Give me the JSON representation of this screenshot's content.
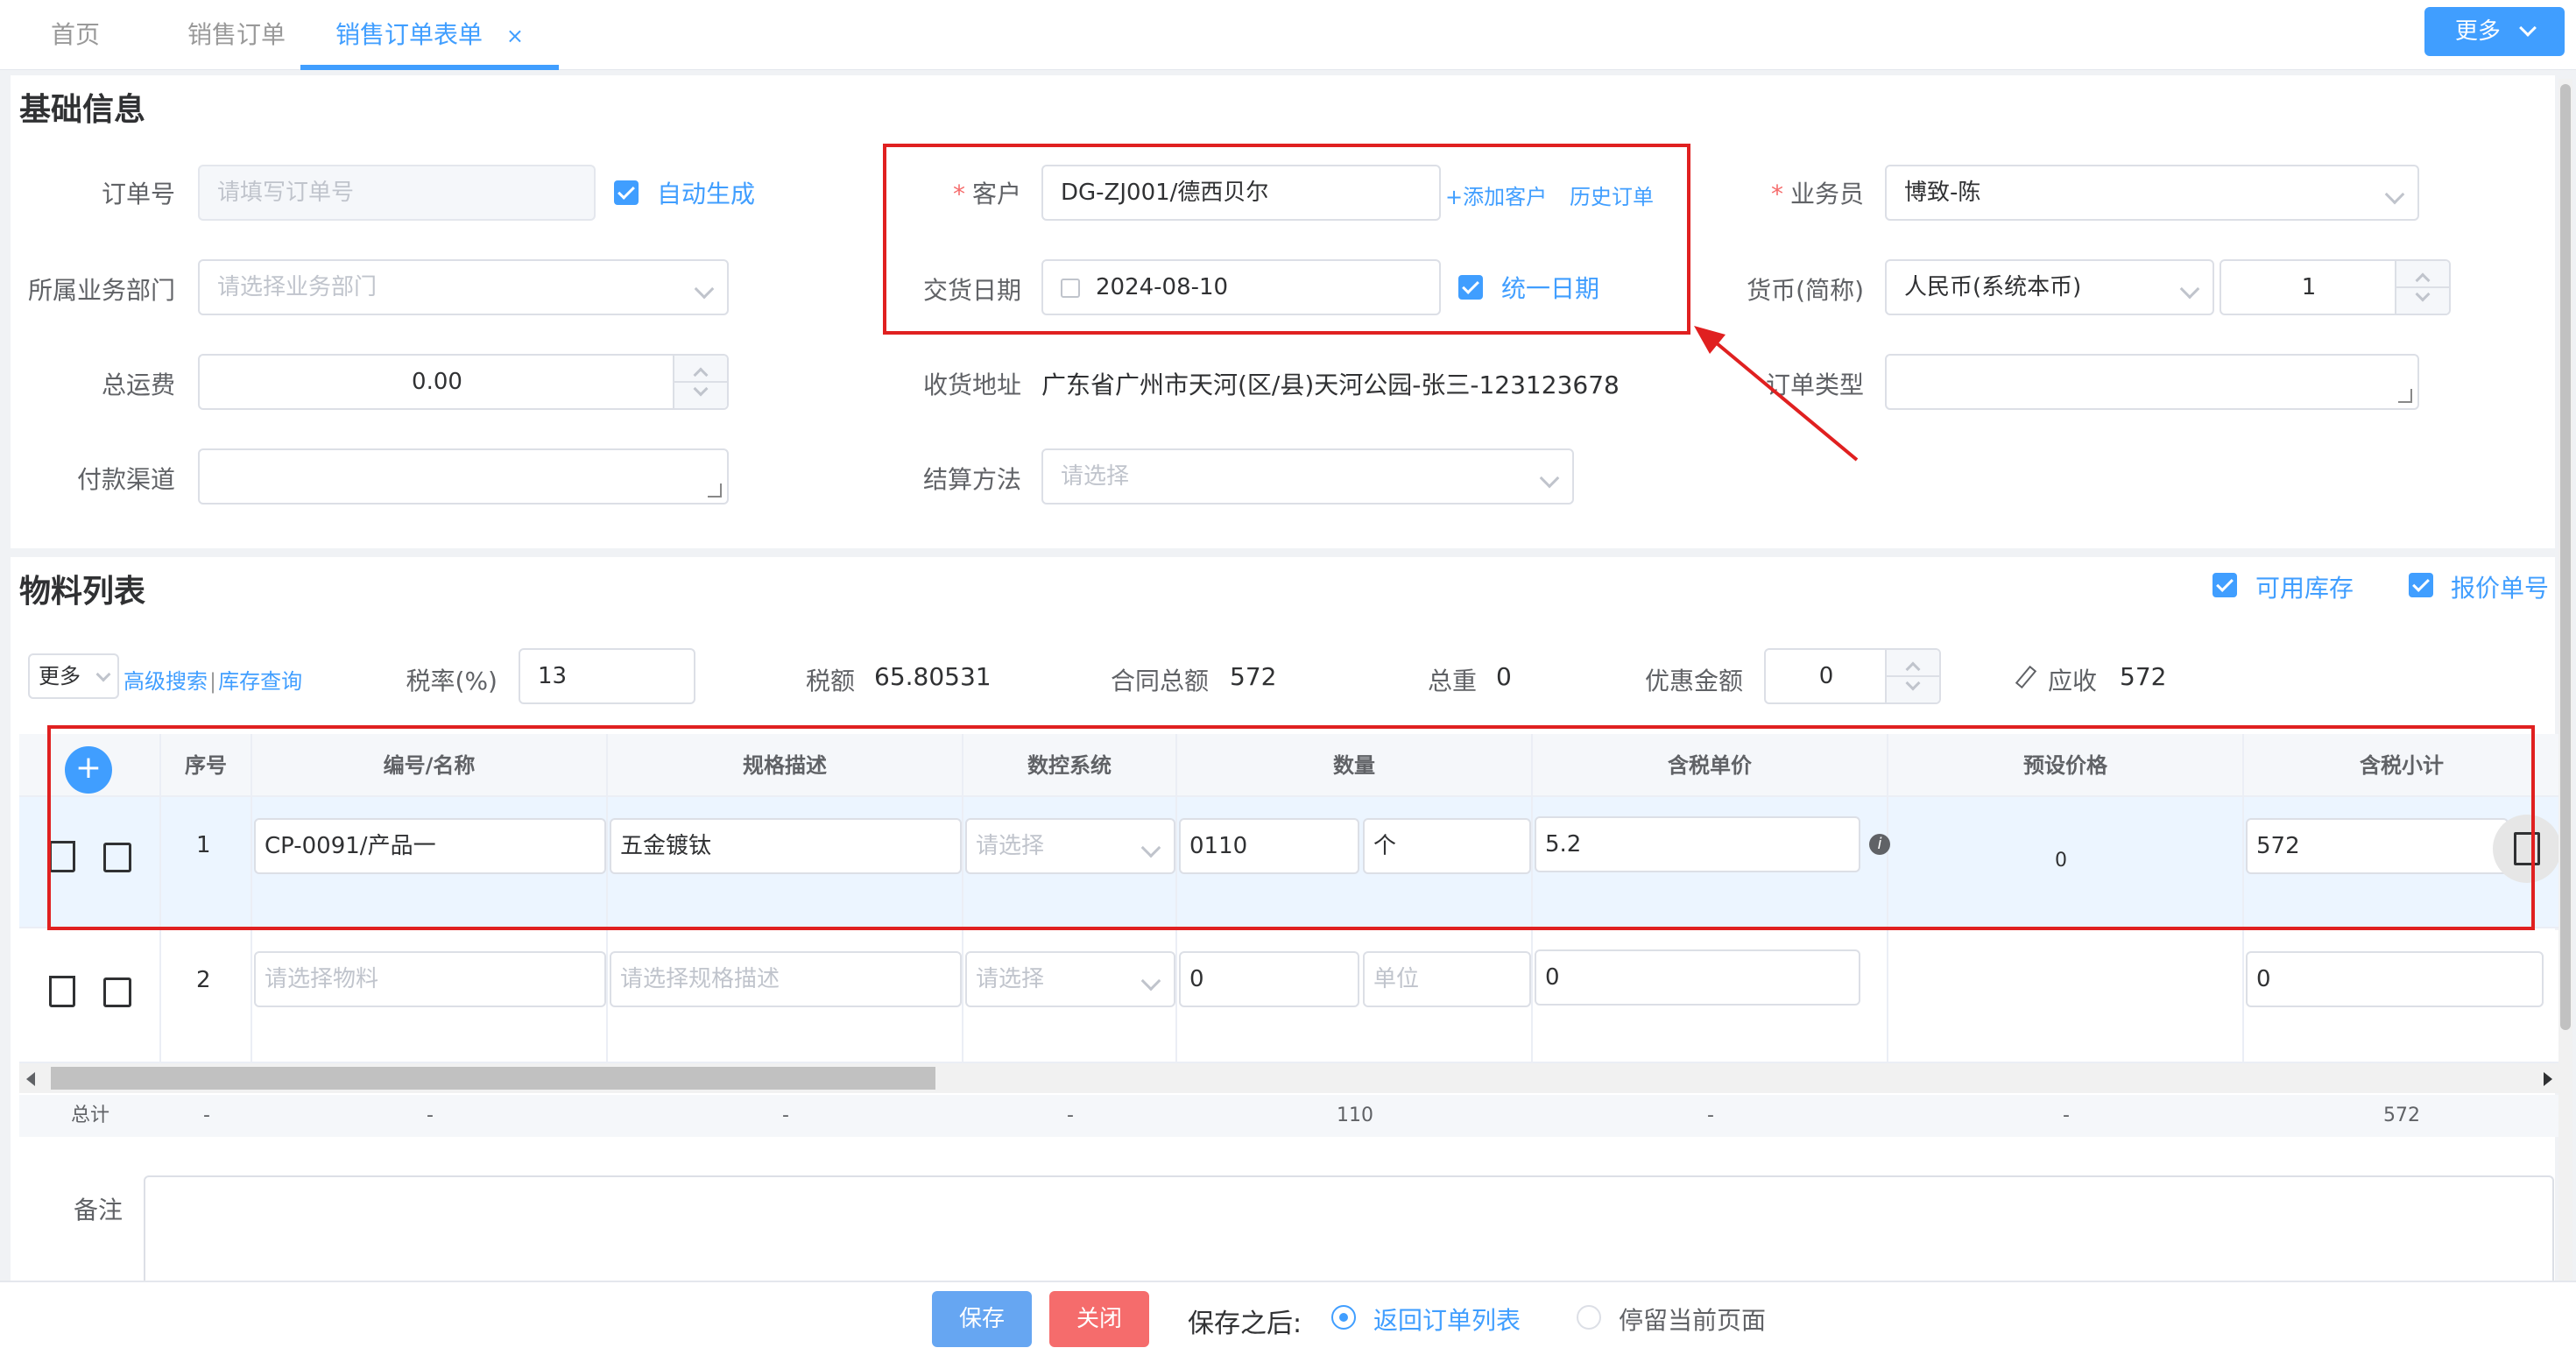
{
  "tabs": [
    "首页",
    "销售订单",
    "销售订单表单"
  ],
  "tab_close": "×",
  "more_button": "更多",
  "basic": {
    "title": "基础信息",
    "order_no_label": "订单号",
    "order_no_placeholder": "请填写订单号",
    "auto_gen_label": "自动生成",
    "customer_label": "客户",
    "customer_value": "DG-ZJ001/德西贝尔",
    "add_customer": "+添加客户",
    "history_order": "历史订单",
    "salesman_label": "业务员",
    "salesman_value": "博致-陈",
    "dept_label": "所属业务部门",
    "dept_placeholder": "请选择业务部门",
    "delivery_label": "交货日期",
    "delivery_value": "2024-08-10",
    "unify_date_label": "统一日期",
    "currency_label": "货币(简称)",
    "currency_value": "人民币(系统本币)",
    "currency_rate": "1",
    "freight_label": "总运费",
    "freight_value": "0.00",
    "address_label": "收货地址",
    "address_value": "广东省广州市天河(区/县)天河公园-张三-123123678",
    "order_type_label": "订单类型",
    "pay_channel_label": "付款渠道",
    "settle_label": "结算方法",
    "settle_placeholder": "请选择"
  },
  "materials": {
    "title": "物料列表",
    "available_stock": "可用库存",
    "quote_no": "报价单号",
    "more_select": "更多",
    "adv_search": "高级搜索",
    "stock_query": "库存查询",
    "sep": "|",
    "tax_rate_label": "税率(%)",
    "tax_rate_value": "13",
    "tax_amount_label": "税额",
    "tax_amount_value": "65.80531",
    "contract_total_label": "合同总额",
    "contract_total_value": "572",
    "total_weight_label": "总重",
    "total_weight_value": "0",
    "discount_label": "优惠金额",
    "discount_value": "0",
    "receivable_label": "应收",
    "receivable_value": "572",
    "columns": [
      "序号",
      "编号/名称",
      "规格描述",
      "数控系统",
      "数量",
      "含税单价",
      "预设价格",
      "含税小计"
    ],
    "rows": [
      {
        "index": "1",
        "code": "CP-0091/产品一",
        "spec": "五金镀钛",
        "system": "请选择",
        "qty": "0110",
        "unit": "个",
        "price": "5.2",
        "preset": "0",
        "subtotal": "572"
      },
      {
        "index": "2",
        "code": "请选择物料",
        "spec": "请选择规格描述",
        "system": "请选择",
        "qty": "0",
        "unit": "单位",
        "price": "0",
        "preset": "",
        "subtotal": "0"
      }
    ],
    "totals": {
      "label": "总计",
      "index": "-",
      "code": "-",
      "spec": "-",
      "system": "-",
      "qty": "110",
      "price": "-",
      "preset": "-",
      "subtotal": "572"
    }
  },
  "remark_label": "备注",
  "footer": {
    "save": "保存",
    "close": "关闭",
    "after_save": "保存之后:",
    "return_list": "返回订单列表",
    "stay_page": "停留当前页面"
  },
  "colors": {
    "primary": "#409eff",
    "danger": "#f56c6c",
    "annotation": "#e02020"
  }
}
